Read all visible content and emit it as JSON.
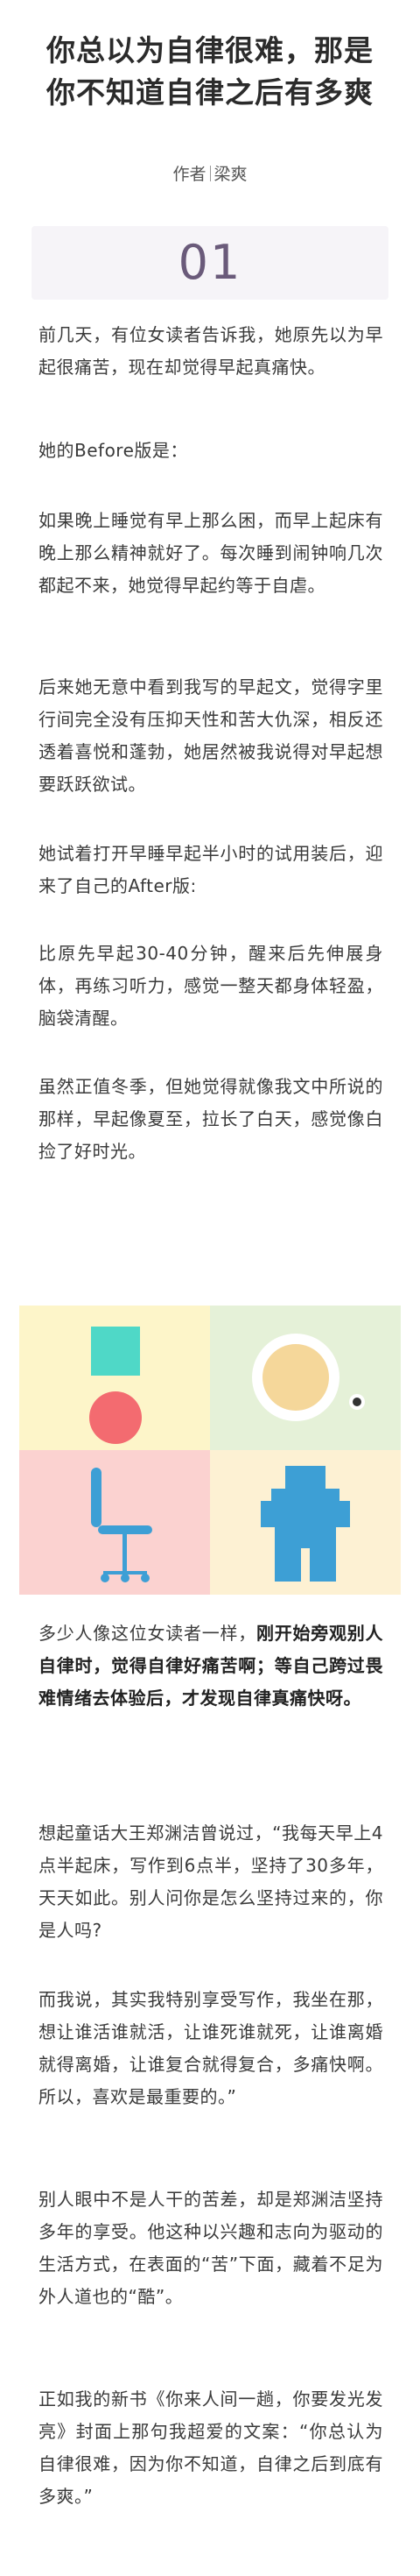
{
  "title": [
    "你总以为自律很难，那是",
    "你不知道自律之后有多爽"
  ],
  "byline": {
    "label": "作者",
    "author": "梁爽"
  },
  "chapter_number": "01",
  "paragraphs": {
    "p1": "前几天，有位女读者告诉我，她原先以为早起很痛苦，现在却觉得早起真痛快。",
    "p2": "她的Before版是：",
    "p3": "如果晚上睡觉有早上那么困，而早上起床有晚上那么精神就好了。每次睡到闹钟响几次都起不来，她觉得早起约等于自虐。",
    "p4": "后来她无意中看到我写的早起文，觉得字里行间完全没有压抑天性和苦大仇深，相反还透着喜悦和蓬勃，她居然被我说得对早起想要跃跃欲试。",
    "p5": "她试着打开早睡早起半小时的试用装后，迎来了自己的After版:",
    "p6": "比原先早起30-40分钟，醒来后先伸展身体，再练习听力，感觉一整天都身体轻盈，脑袋清醒。",
    "p7": "虽然正值冬季，但她觉得就像我文中所说的那样，早起像夏至，拉长了白天，感觉像白捡了好时光。",
    "p8_normal": "多少人像这位女读者一样，",
    "p8_bold": "刚开始旁观别人自律时，觉得自律好痛苦啊；等自己跨过畏难情绪去体验后，才发现自律真痛快呀。",
    "p9": "想起童话大王郑渊洁曾说过，“我每天早上4点半起床，写作到6点半，坚持了30多年，天天如此。别人问你是怎么坚持过来的，你是人吗?",
    "p10": "而我说，其实我特别享受写作，我坐在那，想让谁活谁就活，让谁死谁就死，让谁离婚就得离婚，让谁复合就得复合，多痛快啊。所以，喜欢是最重要的。”",
    "p11": "别人眼中不是人干的苦差，却是郑渊洁坚持多年的享受。他这种以兴趣和志向为驱动的生活方式，在表面的“苦”下面，藏着不足为外人道也的“酷”。",
    "p12_bold": "正如我的新书《你来人间一趟，你要发光发亮》封面上那句我超爱的文案：“你总认为自律很难，因为你不知道，自律之后到底有多爽。”"
  },
  "illustration": {
    "colors": {
      "q1_bg": "#fdf5c9",
      "q2_bg": "#e5f1d8",
      "q3_bg": "#fbd2d0",
      "q4_bg": "#fdf1d3",
      "teal": "#4fd8c7",
      "red": "#f36b70",
      "blue": "#3d9fd5",
      "plate": "#f5d79a",
      "dark": "#333333"
    }
  }
}
